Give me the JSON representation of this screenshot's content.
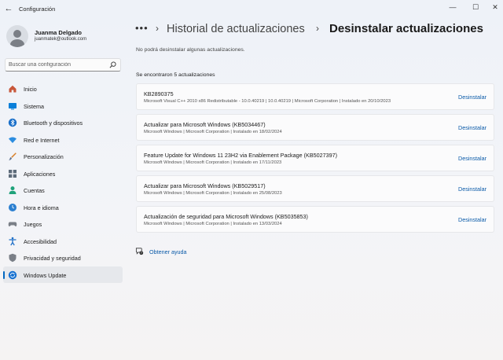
{
  "window": {
    "title": "Configuración",
    "controls": [
      "minimize",
      "maximize",
      "close"
    ]
  },
  "profile": {
    "name": "Juanma Delgado",
    "email": "juanmatek@outlook.com"
  },
  "search": {
    "placeholder": "Buscar una configuración",
    "value": ""
  },
  "sidebar": {
    "items": [
      {
        "label": "Inicio",
        "icon": "home-icon",
        "color": "#c8573a"
      },
      {
        "label": "Sistema",
        "icon": "monitor-icon",
        "color": "#0a7fd9"
      },
      {
        "label": "Bluetooth y dispositivos",
        "icon": "bluetooth-icon",
        "color": "#1a6fc9"
      },
      {
        "label": "Red e Internet",
        "icon": "wifi-icon",
        "color": "#2c8de0"
      },
      {
        "label": "Personalización",
        "icon": "brush-icon",
        "color": "#d9822b"
      },
      {
        "label": "Aplicaciones",
        "icon": "apps-icon",
        "color": "#5d6b7a"
      },
      {
        "label": "Cuentas",
        "icon": "person-icon",
        "color": "#1fa27a"
      },
      {
        "label": "Hora e idioma",
        "icon": "globe-clock-icon",
        "color": "#2b7fd0"
      },
      {
        "label": "Juegos",
        "icon": "gamepad-icon",
        "color": "#7a7f87"
      },
      {
        "label": "Accesibilidad",
        "icon": "accessibility-icon",
        "color": "#1f6fc7"
      },
      {
        "label": "Privacidad y seguridad",
        "icon": "shield-icon",
        "color": "#7a7f87"
      },
      {
        "label": "Windows Update",
        "icon": "update-icon",
        "color": "#1a73d1"
      }
    ],
    "active_index": 11
  },
  "breadcrumb": {
    "more": "•••",
    "parent": "Historial de actualizaciones",
    "current": "Desinstalar actualizaciones"
  },
  "main": {
    "warning": "No podrá desinstalar algunas actualizaciones.",
    "count_label": "Se encontraron 5 actualizaciones",
    "uninstall_label": "Desinstalar",
    "updates": [
      {
        "name": "KB2890375",
        "details": "Microsoft Visual C++ 2010  x86 Redistributable - 10.0.40219   |   10.0.40219   |   Microsoft Corporation   |   Instalado en 20/10/2023"
      },
      {
        "name": "Actualizar para Microsoft Windows (KB5034467)",
        "details": "Microsoft Windows   |   Microsoft Corporation   |   Instalado en 18/02/2024"
      },
      {
        "name": "Feature Update for Windows 11 23H2 via Enablement Package (KB5027397)",
        "details": "Microsoft Windows   |   Microsoft Corporation   |   Instalado en 17/11/2023"
      },
      {
        "name": "Actualizar para Microsoft Windows (KB5029517)",
        "details": "Microsoft Windows   |   Microsoft Corporation   |   Instalado en 25/08/2023"
      },
      {
        "name": "Actualización de seguridad para Microsoft Windows (KB5035853)",
        "details": "Microsoft Windows   |   Microsoft Corporation   |   Instalado en 13/03/2024"
      }
    ],
    "help_label": "Obtener ayuda"
  },
  "colors": {
    "accent": "#0067c0",
    "link": "#0a5aa8"
  }
}
